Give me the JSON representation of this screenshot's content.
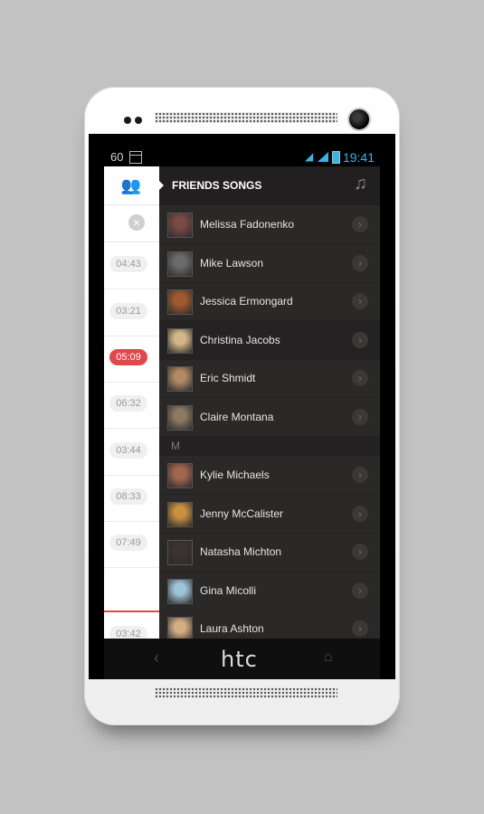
{
  "status": {
    "num": "60",
    "time": "19:41"
  },
  "drawer": {
    "title": "FRIENDS SONGS"
  },
  "times": [
    "04:43",
    "03:21",
    "05:09",
    "06:32",
    "03:44",
    "08:33",
    "07:49",
    "03:42"
  ],
  "friends": [
    {
      "name": "Melissa Fadonenko",
      "color": "#7a4a44"
    },
    {
      "name": "Mike Lawson",
      "color": "#6b6b6b"
    },
    {
      "name": "Jessica Ermongard",
      "color": "#a05a2f"
    },
    {
      "name": "Christina Jacobs",
      "color": "#d3b788"
    },
    {
      "name": "Eric Shmidt",
      "color": "#b08a64"
    },
    {
      "name": "Claire Montana",
      "color": "#8c7a62"
    }
  ],
  "section_letter": "M",
  "friends_m": [
    {
      "name": "Kylie Michaels",
      "color": "#a06650"
    },
    {
      "name": "Jenny McCalister",
      "color": "#c9913d"
    },
    {
      "name": "Natasha Michton",
      "color": "#3a3432"
    },
    {
      "name": "Gina Micolli",
      "color": "#9fc4d8"
    },
    {
      "name": "Laura Ashton",
      "color": "#d4ad83"
    }
  ],
  "brand": {
    "logo": "htc"
  }
}
